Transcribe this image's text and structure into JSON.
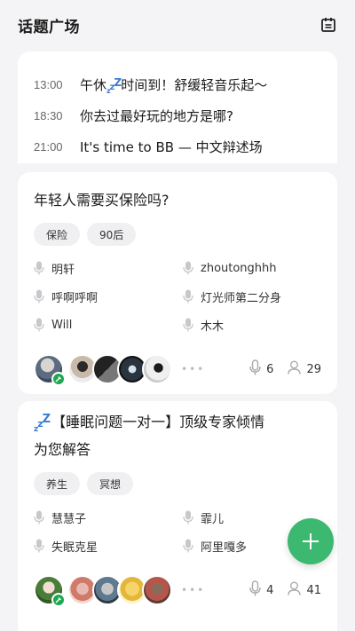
{
  "header": {
    "title": "话题广场",
    "calendar_icon": "calendar-icon"
  },
  "schedule": [
    {
      "time": "13:00",
      "text_before": "午休",
      "zzz": true,
      "text_after": "时间到！舒缓轻音乐起～"
    },
    {
      "time": "18:30",
      "text_before": "你去过最好玩的地方是哪?",
      "zzz": false,
      "text_after": ""
    },
    {
      "time": "21:00",
      "text_before": "It's time to BB — 中文辩述场",
      "zzz": false,
      "text_after": ""
    }
  ],
  "rooms": [
    {
      "title": "年轻人需要买保险吗?",
      "tags": [
        "保险",
        "90后"
      ],
      "speakers": [
        "明轩",
        "zhoutonghhh",
        "呼啊呼啊",
        "灯光师第二分身",
        "Will",
        "木木"
      ],
      "mic_count": "6",
      "listener_count": "29"
    },
    {
      "title_line1": "【睡眠问题一对一】顶级专家倾情",
      "title_line2": "为您解答",
      "tags": [
        "养生",
        "冥想"
      ],
      "speakers": [
        "慧慧子",
        "霏儿",
        "失眠克星",
        "阿里嘎多"
      ],
      "mic_count": "4",
      "listener_count": "41"
    }
  ],
  "colors": {
    "accent": "#3cb871",
    "host_badge": "#1fa851",
    "zzz": "#3a7bd5"
  }
}
